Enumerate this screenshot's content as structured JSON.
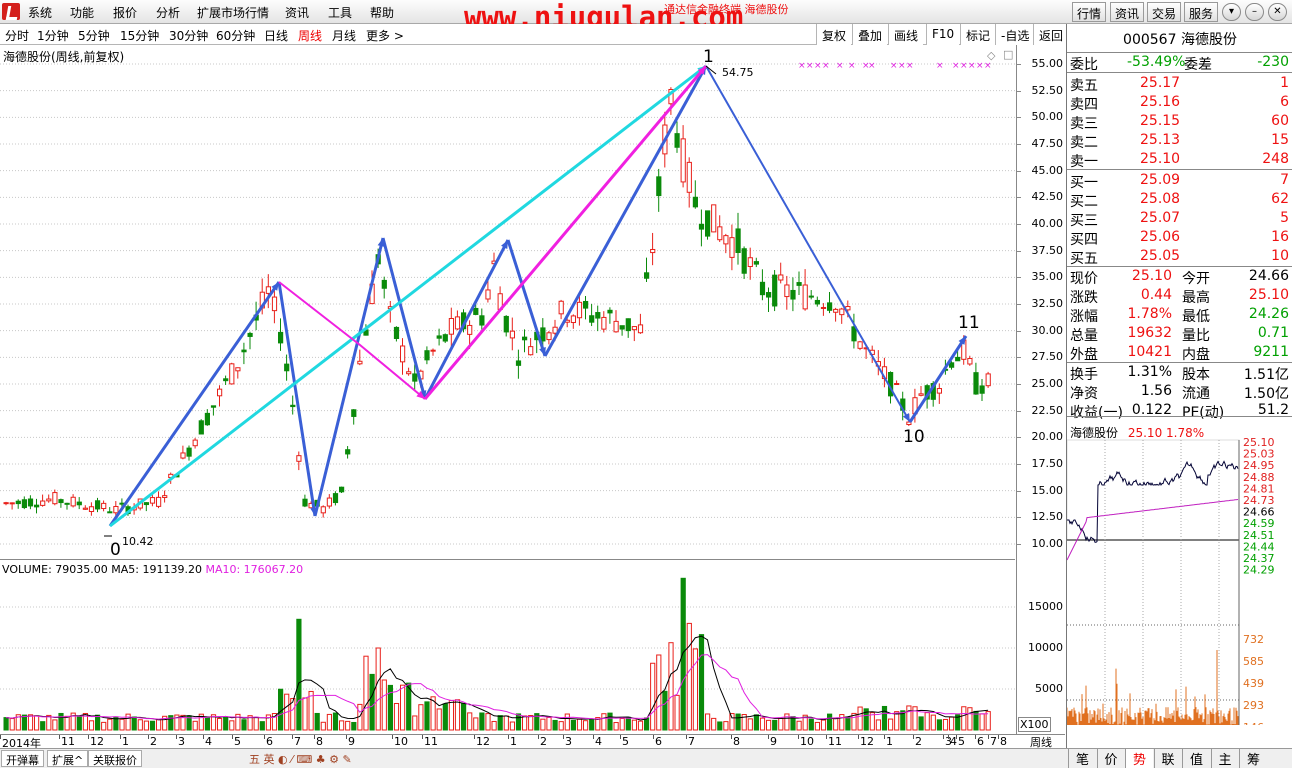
{
  "menubar": {
    "items": [
      "系统",
      "功能",
      "报价",
      "分析",
      "扩展市场行情",
      "资讯",
      "工具",
      "帮助"
    ],
    "watermark": "www.niugulan.com",
    "title_behind": "通达信金融终端 海德股份",
    "right_buttons": [
      "行情",
      "资讯",
      "交易",
      "服务"
    ]
  },
  "toolbar": {
    "periods": [
      "分时",
      "1分钟",
      "5分钟",
      "15分钟",
      "30分钟",
      "60分钟",
      "日线",
      "周线",
      "月线",
      "更多 >"
    ],
    "active_period": "周线",
    "right_buttons": [
      "复权",
      "叠加",
      "画线",
      "F10",
      "标记",
      "-自选",
      "返回"
    ]
  },
  "chart": {
    "title": "海德股份(周线,前复权)",
    "y_ticks": [
      "55.00",
      "52.50",
      "50.00",
      "47.50",
      "45.00",
      "42.50",
      "40.00",
      "37.50",
      "35.00",
      "32.50",
      "30.00",
      "27.50",
      "25.00",
      "22.50",
      "20.00",
      "17.50",
      "15.00",
      "12.50",
      "10.00"
    ],
    "annotations": {
      "low_label": "10.42",
      "high_label": "54.75",
      "wave_labels": [
        "0",
        "1",
        "10",
        "11"
      ]
    },
    "colors": {
      "up": "#e8201a",
      "down": "#0a8a0a",
      "blue_line": "#3a5fd6",
      "magenta_line": "#f020e0",
      "cyan_line": "#20d8e0"
    }
  },
  "chart_data": {
    "type": "candlestick",
    "period": "weekly",
    "ylim": [
      10,
      55
    ],
    "low": 10.42,
    "high": 54.75,
    "wave_points": [
      {
        "label": "0",
        "value": 10.42
      },
      {
        "label": "1",
        "value": 54.75
      },
      {
        "label": "10",
        "value": 21.5
      },
      {
        "label": "11",
        "value": 29.6
      }
    ]
  },
  "volume": {
    "header": "VOLUME: 79035.00",
    "ma5": "MA5: 191139.20",
    "ma10": "MA10: 176067.20",
    "y_ticks": [
      "15000",
      "10000",
      "5000"
    ],
    "unit": "X100"
  },
  "xaxis": {
    "labels": [
      "2014年",
      "11",
      "12",
      "1",
      "2",
      "3",
      "4",
      "5",
      "6",
      "7",
      "8",
      "9",
      "10",
      "11",
      "12",
      "1",
      "2",
      "3",
      "4",
      "5",
      "6",
      "7",
      "8",
      "9",
      "10",
      "11",
      "12",
      "1",
      "2",
      "3",
      "4",
      "5",
      "6",
      "7",
      "8"
    ],
    "right_label": "周线"
  },
  "bottombar": {
    "buttons": [
      "开弹幕",
      "扩展^",
      "关联报价"
    ]
  },
  "quote": {
    "code": "000567",
    "name": "海德股份",
    "weibi_label": "委比",
    "weibi": "-53.49%",
    "weicha_label": "委差",
    "weicha": "-230",
    "asks": [
      {
        "label": "卖五",
        "price": "25.17",
        "vol": "1"
      },
      {
        "label": "卖四",
        "price": "25.16",
        "vol": "6"
      },
      {
        "label": "卖三",
        "price": "25.15",
        "vol": "60"
      },
      {
        "label": "卖二",
        "price": "25.13",
        "vol": "15"
      },
      {
        "label": "卖一",
        "price": "25.10",
        "vol": "248"
      }
    ],
    "bids": [
      {
        "label": "买一",
        "price": "25.09",
        "vol": "7"
      },
      {
        "label": "买二",
        "price": "25.08",
        "vol": "62"
      },
      {
        "label": "买三",
        "price": "25.07",
        "vol": "5"
      },
      {
        "label": "买四",
        "price": "25.06",
        "vol": "16"
      },
      {
        "label": "买五",
        "price": "25.05",
        "vol": "10"
      }
    ],
    "stats": [
      {
        "l1": "现价",
        "v1": "25.10",
        "l2": "今开",
        "v2": "24.66"
      },
      {
        "l1": "涨跌",
        "v1": "0.44",
        "l2": "最高",
        "v2": "25.10"
      },
      {
        "l1": "涨幅",
        "v1": "1.78%",
        "l2": "最低",
        "v2": "24.26"
      },
      {
        "l1": "总量",
        "v1": "19632",
        "l2": "量比",
        "v2": "0.71"
      },
      {
        "l1": "外盘",
        "v1": "10421",
        "l2": "内盘",
        "v2": "9211"
      }
    ],
    "stats2": [
      {
        "l1": "换手",
        "v1": "1.31%",
        "l2": "股本",
        "v2": "1.51亿"
      },
      {
        "l1": "净资",
        "v1": "1.56",
        "l2": "流通",
        "v2": "1.50亿"
      },
      {
        "l1": "收益(一)",
        "v1": "0.122",
        "l2": "PE(动)",
        "v2": "51.2"
      }
    ]
  },
  "mini": {
    "name": "海德股份",
    "price": "25.10",
    "pct": "1.78%",
    "price_ticks": [
      "25.10",
      "25.03",
      "24.95",
      "24.88",
      "24.81",
      "24.73",
      "24.66",
      "24.59",
      "24.51",
      "24.44",
      "24.37",
      "24.29"
    ],
    "vol_ticks": [
      "732",
      "585",
      "439",
      "293",
      "146"
    ]
  },
  "right_tabs": [
    "笔",
    "价",
    "势",
    "联",
    "值",
    "主",
    "筹"
  ],
  "active_right_tab": "势"
}
